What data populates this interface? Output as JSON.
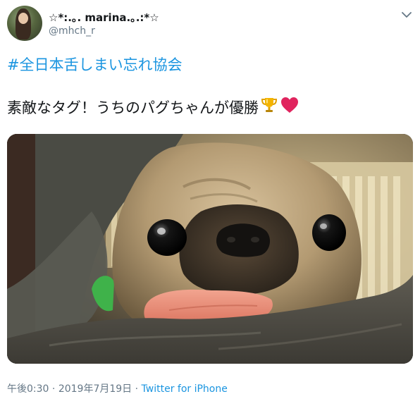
{
  "user": {
    "display_name": "☆*:.｡. marina.｡.:*☆",
    "handle": "@mhch_r"
  },
  "tweet": {
    "hashtag": "#全日本舌しまい忘れ協会",
    "text": "素敵なタグ！うちのパグちゃんが優勝",
    "emojis": [
      "trophy-icon",
      "red-heart-icon"
    ]
  },
  "meta": {
    "time": "午後0:30",
    "separator": " · ",
    "date": "2019年7月19日",
    "separator2": " · ",
    "source": "Twitter for iPhone"
  },
  "colors": {
    "link": "#1b95e0",
    "secondary_text": "#657786",
    "primary_text": "#14171a",
    "heart": "#e0245e",
    "trophy": "#f4b400"
  }
}
